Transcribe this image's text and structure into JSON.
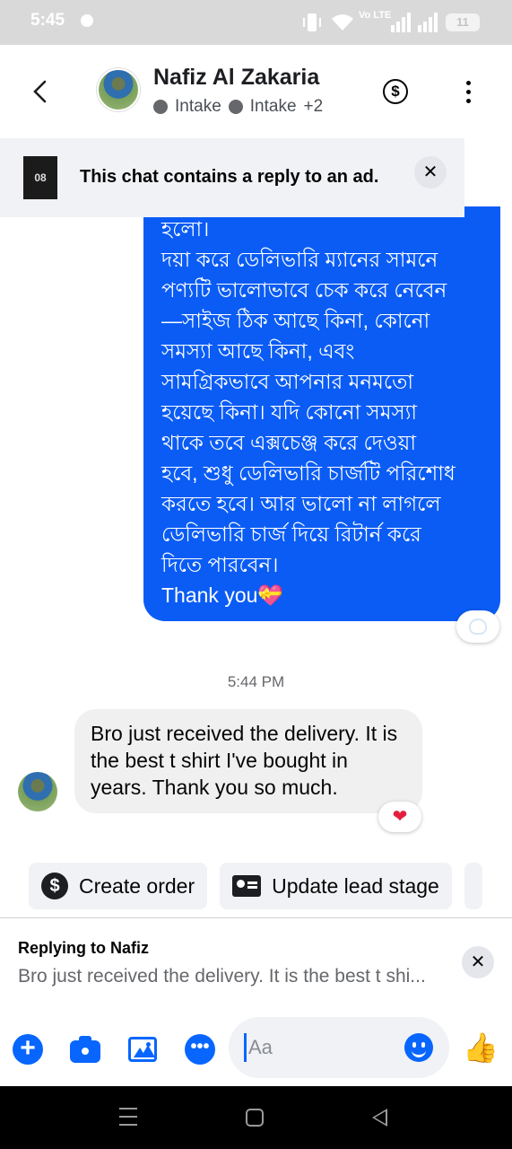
{
  "status_bar": {
    "time": "5:45",
    "network_label": "Vo LTE",
    "battery": "11"
  },
  "header": {
    "contact_name": "Nafiz Al Zakaria",
    "stage_1": "Intake",
    "stage_2": "Intake",
    "more_stages": "+2",
    "back_icon": "chevron-left-icon",
    "payment_icon": "dollar-circle-icon",
    "menu_icon": "vertical-dots-icon"
  },
  "ad_banner": {
    "text": "This chat contains a reply to an ad.",
    "thumb_text": "08",
    "close_icon": "close-icon"
  },
  "messages": {
    "outgoing_lines": [
      "হলো।",
      "দয়া করে ডেলিভারি ম্যানের সামনে",
      "পণ্যটি ভালোভাবে চেক করে নেবেন",
      "—সাইজ ঠিক আছে কিনা, কোনো",
      "সমস্যা আছে কিনা, এবং",
      "সামগ্রিকভাবে আপনার মনমতো",
      "হয়েছে কিনা। যদি কোনো সমস্যা",
      "থাকে তবে এক্সচেঞ্জ করে দেওয়া",
      "হবে, শুধু ডেলিভারি চার্জটি পরিশোধ",
      "করতে হবে। আর ভালো না লাগলে",
      "ডেলিভারি চার্জ দিয়ে রিটার্ন করে",
      "দিতে পারবেন।",
      "Thank you💝"
    ],
    "timestamp": "5:44 PM",
    "incoming_text": "Bro just received the delivery. It is the best t shirt I've bought in years. Thank you so much.",
    "incoming_reaction": "❤"
  },
  "actions": {
    "create_order": "Create order",
    "update_lead_stage": "Update lead stage"
  },
  "reply": {
    "title": "Replying to Nafiz",
    "snippet": "Bro just received the delivery. It is the best t shi..."
  },
  "composer": {
    "placeholder": "Aa",
    "accent_color": "#0866ff",
    "like_glyph": "👍"
  },
  "colors": {
    "outgoing_bubble": "#0a5cf5",
    "incoming_bubble": "#f0f0f0",
    "reaction_heart": "#e41e3f"
  }
}
